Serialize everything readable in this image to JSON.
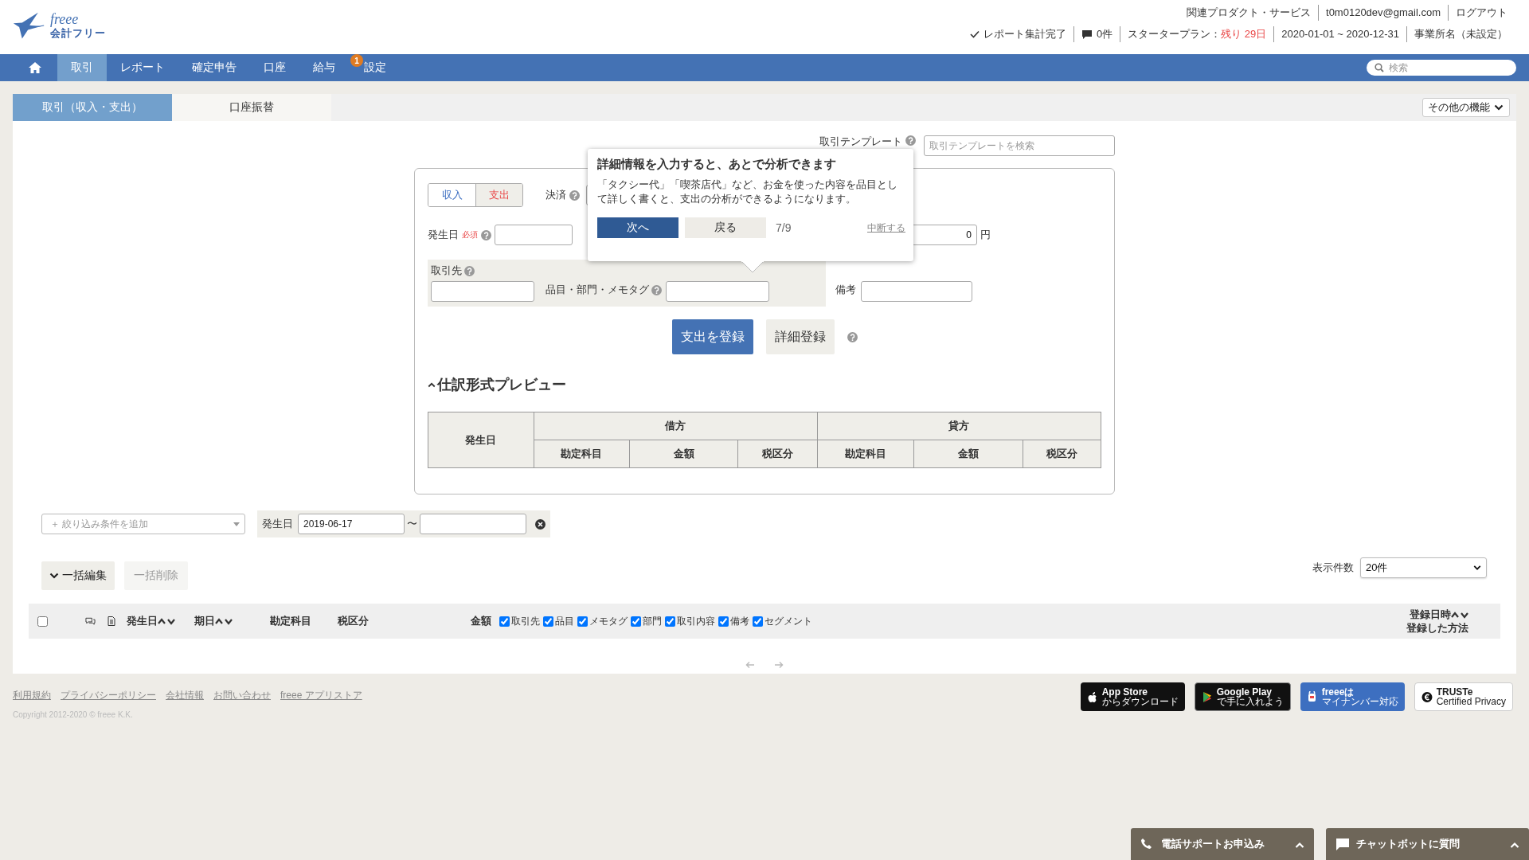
{
  "logo": {
    "wordmark": "freee",
    "product": "会計フリー"
  },
  "header_links": [
    "関連プロダクト・サービス",
    "t0m0120dev@gmail.com",
    "ログアウト"
  ],
  "status_items": [
    {
      "kind": "check",
      "text": "レポート集計完了"
    },
    {
      "kind": "comment",
      "text": "0件"
    },
    {
      "kind": "plan",
      "text": "スタータープラン：",
      "highlight": "残り 29日"
    },
    {
      "kind": "text",
      "text": "2020-01-01 ~ 2020-12-31"
    },
    {
      "kind": "text",
      "text": "事業所名（未設定）"
    }
  ],
  "nav": {
    "items": [
      {
        "kind": "home",
        "selected": false
      },
      {
        "kind": "label",
        "label": "取引",
        "selected": true
      },
      {
        "kind": "label",
        "label": "レポート",
        "selected": false
      },
      {
        "kind": "label",
        "label": "確定申告",
        "selected": false
      },
      {
        "kind": "label",
        "label": "口座",
        "selected": false
      },
      {
        "kind": "label",
        "label": "給与",
        "selected": false
      },
      {
        "kind": "label",
        "label": "設定",
        "selected": false,
        "badge": "1"
      }
    ],
    "search": {
      "placeholder": "検索"
    }
  },
  "tabs": [
    {
      "label": "取引（収入・支出）",
      "selected": true
    },
    {
      "label": "口座振替",
      "selected": false
    }
  ],
  "more_button": "その他の機能",
  "template": {
    "label": "取引テンプレート",
    "placeholder": "取引テンプレートを検索"
  },
  "form": {
    "type_toggle": [
      {
        "label": "収入",
        "selected": false
      },
      {
        "label": "支出",
        "selected": true
      }
    ],
    "settlement_label": "決済",
    "date_label": "発生日",
    "required": "必須",
    "amount": "0",
    "currency": "円",
    "partner_label": "取引先",
    "item_label": "品目・部門・メモタグ",
    "note_label": "備考",
    "submit": "支出を登録",
    "detail": "詳細登録"
  },
  "preview": {
    "title": "仕訳形式プレビュー",
    "expanded": true,
    "date_col": "発生日",
    "debit": "借方",
    "credit": "貸方",
    "sub_columns": [
      "勘定科目",
      "金額",
      "税区分",
      "勘定科目",
      "金額",
      "税区分"
    ]
  },
  "tooltip": {
    "title": "詳細情報を入力すると、あとで分析できます",
    "body": "「タクシー代」「喫茶店代」など、お金を使った内容を品目として詳しく書くと、支出の分析ができるようになります。",
    "next": "次へ",
    "back": "戻る",
    "progress": "7/9",
    "abort": "中断する"
  },
  "filter": {
    "placeholder": "＋ 絞り込み条件を追加",
    "date_label": "発生日",
    "from": "2019-06-17",
    "separator": "〜"
  },
  "bulk": {
    "edit": "一括編集",
    "delete": "一括削除",
    "delete_disabled": true
  },
  "page_size": {
    "label": "表示件数",
    "value": "20件"
  },
  "list_header": {
    "checked": false,
    "columns": [
      {
        "label": "発生日",
        "sortable": true
      },
      {
        "label": "期日",
        "sortable": true
      },
      {
        "label": "勘定科目",
        "sortable": false
      },
      {
        "label": "税区分",
        "sortable": false
      }
    ],
    "amount": "金額",
    "toggles": [
      {
        "label": "取引先",
        "checked": true
      },
      {
        "label": "品目",
        "checked": true
      },
      {
        "label": "メモタグ",
        "checked": true
      },
      {
        "label": "部門",
        "checked": true
      },
      {
        "label": "取引内容",
        "checked": true
      },
      {
        "label": "備考",
        "checked": true
      },
      {
        "label": "セグメント",
        "checked": true
      }
    ],
    "registered": {
      "label": "登録日時",
      "sortable": true
    },
    "method": "登録した方法"
  },
  "footer": {
    "links": [
      "利用規約",
      "プライバシーポリシー",
      "会社情報",
      "お問い合わせ",
      "freee アプリストア"
    ],
    "copyright": "Copyright 2012-2020 © freee K.K.",
    "badges": [
      {
        "kind": "apple",
        "lines": [
          "App Store",
          "からダウンロード"
        ]
      },
      {
        "kind": "google",
        "lines": [
          "Google Play",
          "で手に入れよう"
        ]
      },
      {
        "kind": "mynumber",
        "lines": [
          "freeeは",
          "マイナンバー対応"
        ]
      },
      {
        "kind": "truste",
        "lines": [
          "TRUSTe",
          "Certified Privacy"
        ]
      }
    ]
  },
  "support": [
    {
      "kind": "phone",
      "label": "電話サポートお申込み"
    },
    {
      "kind": "chat",
      "label": "チャットボットに質問"
    }
  ]
}
